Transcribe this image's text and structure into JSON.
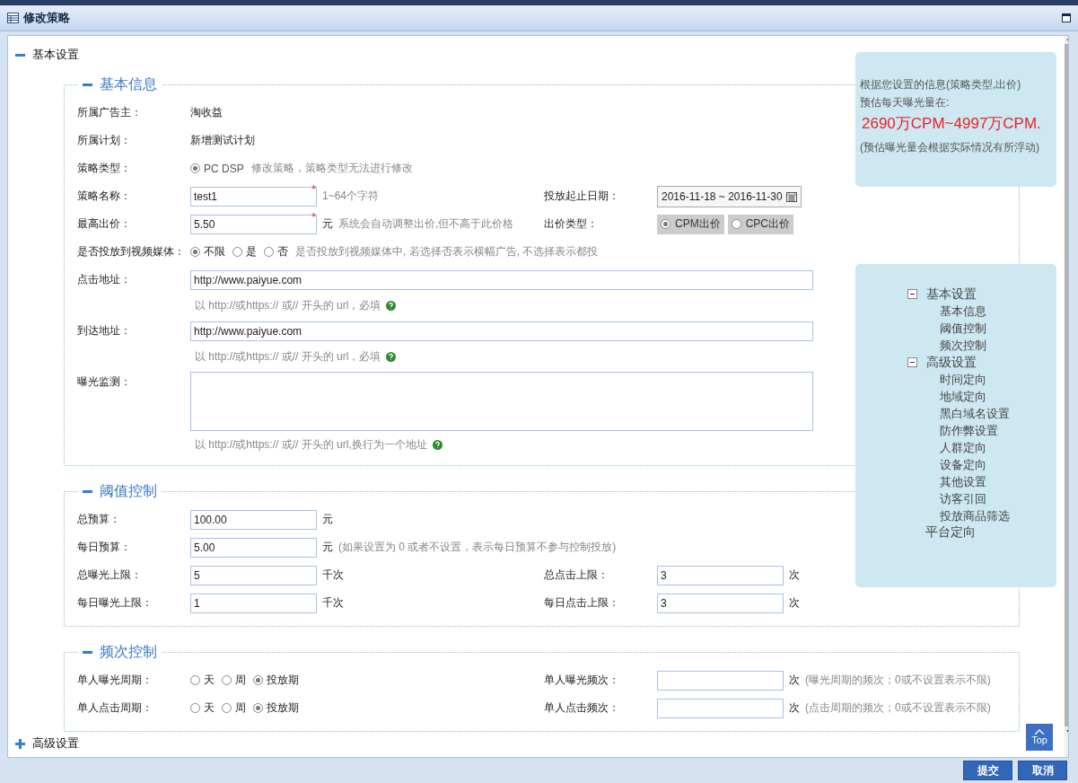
{
  "window": {
    "title": "修改策略"
  },
  "sections": [
    {
      "title": "基本设置",
      "expanded": true,
      "groups": [
        {
          "title": "基本信息",
          "expanded": true,
          "rows": [
            {
              "left": {
                "kind": "static",
                "label": "所属广告主：",
                "value": "淘收益"
              }
            },
            {
              "left": {
                "kind": "static",
                "label": "所属计划：",
                "value": "新增测试计划"
              }
            },
            {
              "left": {
                "kind": "radio",
                "label": "策略类型：",
                "disabled": true,
                "options": [
                  {
                    "text": "PC DSP",
                    "selected": true
                  }
                ],
                "note": "修改策略，策略类型无法进行修改"
              }
            },
            {
              "left": {
                "kind": "input",
                "label": "策略名称：",
                "value": "test1",
                "required_mark": "*",
                "note": "1~64个字符"
              },
              "right": {
                "kind": "date",
                "label": "投放起止日期：",
                "value": "2016-11-18 ~ 2016-11-30"
              }
            },
            {
              "left": {
                "kind": "input",
                "label": "最高出价：",
                "value": "5.50",
                "required_mark": "*",
                "unit": "元",
                "note": "系统会自动调整出价,但不高于此价格"
              },
              "right": {
                "kind": "boxed-radio",
                "label": "出价类型：",
                "options": [
                  {
                    "text": "CPM出价",
                    "selected": true
                  },
                  {
                    "text": "CPC出价",
                    "selected": false
                  }
                ]
              }
            },
            {
              "left": {
                "kind": "radio",
                "label": "是否投放到视频媒体：",
                "disabled": false,
                "options": [
                  {
                    "text": "不限",
                    "selected": true
                  },
                  {
                    "text": "是",
                    "selected": false
                  },
                  {
                    "text": "否",
                    "selected": false
                  }
                ],
                "note": "是否投放到视频媒体中, 若选择否表示横幅广告, 不选择表示都投"
              }
            },
            {
              "left": {
                "kind": "url",
                "label": "点击地址：",
                "value": "http://www.paiyue.com",
                "help": "以 http://或https:// 或// 开头的 url，必填"
              }
            },
            {
              "left": {
                "kind": "url",
                "label": "到达地址：",
                "value": "http://www.paiyue.com",
                "help": "以 http://或https:// 或// 开头的 url，必填"
              }
            },
            {
              "left": {
                "kind": "textarea",
                "label": "曝光监测：",
                "help": "以 http://或https:// 或// 开头的 url,换行为一个地址"
              }
            }
          ]
        },
        {
          "title": "阈值控制",
          "expanded": true,
          "rows": [
            {
              "left": {
                "kind": "input",
                "label": "总预算：",
                "value": "100.00",
                "unit": "元"
              }
            },
            {
              "left": {
                "kind": "input",
                "label": "每日预算：",
                "value": "5.00",
                "unit": "元",
                "note": "(如果设置为 0 或者不设置，表示每日预算不参与控制投放)"
              }
            },
            {
              "left": {
                "kind": "input",
                "label": "总曝光上限：",
                "value": "5",
                "unit": "千次"
              },
              "right": {
                "kind": "input",
                "label": "总点击上限：",
                "value": "3",
                "unit": "次"
              }
            },
            {
              "left": {
                "kind": "input",
                "label": "每日曝光上限：",
                "value": "1",
                "unit": "千次"
              },
              "right": {
                "kind": "input",
                "label": "每日点击上限：",
                "value": "3",
                "unit": "次"
              }
            }
          ]
        },
        {
          "title": "频次控制",
          "expanded": true,
          "rows": [
            {
              "left": {
                "kind": "radio",
                "label": "单人曝光周期：",
                "disabled": false,
                "options": [
                  {
                    "text": "天",
                    "selected": false
                  },
                  {
                    "text": "周",
                    "selected": false
                  },
                  {
                    "text": "投放期",
                    "selected": true
                  }
                ]
              },
              "right": {
                "kind": "input",
                "label": "单人曝光频次：",
                "unit": "次",
                "note": "(曝光周期的频次；0或不设置表示不限)"
              }
            },
            {
              "left": {
                "kind": "radio",
                "label": "单人点击周期：",
                "disabled": false,
                "options": [
                  {
                    "text": "天",
                    "selected": false
                  },
                  {
                    "text": "周",
                    "selected": false
                  },
                  {
                    "text": "投放期",
                    "selected": true
                  }
                ]
              },
              "right": {
                "kind": "input",
                "label": "单人点击频次：",
                "unit": "次",
                "note": "(点击周期的频次；0或不设置表示不限)"
              }
            }
          ]
        }
      ]
    },
    {
      "title": "高级设置",
      "expanded": false
    }
  ],
  "estimate": {
    "intro": "根据您设置的信息(策略类型,出价)",
    "lead": "预估每天曝光量在:",
    "range": "2690万CPM~4997万CPM.",
    "footnote": "(预估曝光量会根据实际情况有所浮动)"
  },
  "outline": [
    {
      "label": "基本设置",
      "expanded": true,
      "children": [
        {
          "label": "基本信息"
        },
        {
          "label": "阈值控制"
        },
        {
          "label": "频次控制"
        }
      ]
    },
    {
      "label": "高级设置",
      "expanded": true,
      "children": [
        {
          "label": "时间定向"
        },
        {
          "label": "地域定向"
        },
        {
          "label": "黑白域名设置"
        },
        {
          "label": "防作弊设置"
        },
        {
          "label": "人群定向"
        },
        {
          "label": "设备定向"
        },
        {
          "label": "其他设置"
        },
        {
          "label": "访客引回"
        },
        {
          "label": "投放商品筛选"
        }
      ]
    },
    {
      "label": "平台定向"
    }
  ],
  "top_button": "Top",
  "buttons": [
    "提交",
    "取消"
  ]
}
